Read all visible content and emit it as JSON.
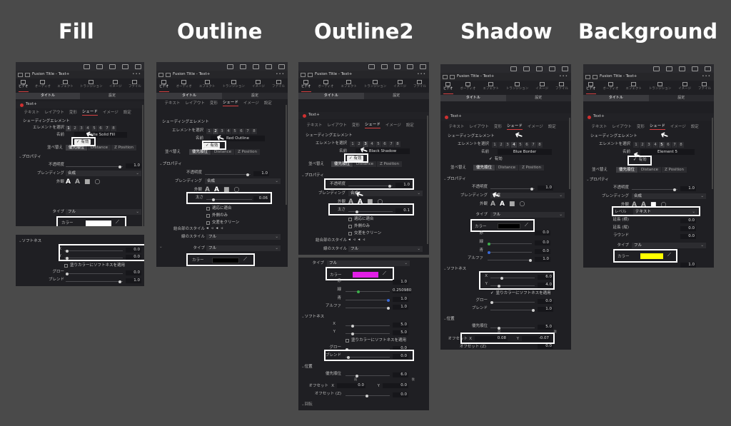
{
  "columns": [
    {
      "key": "fill",
      "title": "Fill"
    },
    {
      "key": "outline",
      "title": "Outline"
    },
    {
      "key": "outline2",
      "title": "Outline2"
    },
    {
      "key": "shadow",
      "title": "Shadow"
    },
    {
      "key": "background",
      "title": "Background"
    }
  ],
  "common": {
    "window_title": "Fusion Title - Text+",
    "more": "•••",
    "tabs": [
      "ビデオ",
      "オーディオ",
      "エフェクト",
      "トランジション",
      "イメージ",
      "ファイル"
    ],
    "subtabs": [
      "タイトル",
      "設定"
    ],
    "tool_name": "Text+",
    "inner_tabs": [
      "テキスト",
      "レイアウト",
      "変形",
      "シェード",
      "イメージ",
      "設定"
    ],
    "shading_element": "シェーディングエレメント",
    "select_element": "エレメントを選択",
    "element_numbers": [
      "1",
      "2",
      "3",
      "4",
      "5",
      "6",
      "7",
      "8"
    ],
    "name_label": "名前",
    "enabled": "有効",
    "sort_label": "並べ替え",
    "sort_options": [
      "優先順位",
      "Distance",
      "Z Position"
    ],
    "properties": "プロパティ",
    "opacity": "不透明度",
    "blending": "ブレンディング",
    "blending_value": "合成",
    "appearance": "外観",
    "type": "タイプ",
    "type_value": "フル",
    "color": "カラー",
    "softness": "ソフトネス",
    "softness_apply": "塗りカラーにソフトネスを適用",
    "glow": "グロー",
    "blend": "ブレンド",
    "size": "太さ",
    "adapt": "適応に適合",
    "outside_only": "外側のみ",
    "cleaner": "交差をクリーン",
    "join_style": "結合部のスタイル",
    "line_style": "線のスタイル",
    "red": "赤",
    "green": "緑",
    "blue": "青",
    "alpha": "アルファ",
    "position": "位置",
    "priority": "優先順位",
    "offset": "オフセット",
    "offset_z": "オフセット (Z)",
    "rotation": "回転",
    "level": "レベル",
    "level_value": "テキスト",
    "extend_h": "延長 (横)",
    "extend_v": "延長 (縦)",
    "round": "ラウンド",
    "front": "前",
    "back": "後"
  },
  "fill": {
    "element": "1",
    "name": "White Solid Fill",
    "opacity": "1.0",
    "swatch": "#ffffff",
    "x": "0.0",
    "y": "0.0",
    "glow": "0.0",
    "blend": "1.0"
  },
  "outline": {
    "element": "2",
    "name": "Red Outline",
    "opacity": "1.0",
    "size": "0.06",
    "swatch": "#000000"
  },
  "outline2": {
    "element": "3",
    "name": "Black Shadow",
    "opacity": "1.0",
    "size": "0.1",
    "swatch": "#e21ee6",
    "c1": "1.0",
    "c2": "0.250980",
    "c3": "1.0",
    "alpha": "1.0",
    "x": "5.0",
    "y": "5.0",
    "glow": "0.0",
    "blend": "0.0",
    "priority": "6.0",
    "offx": "0.0",
    "offy": "0.0",
    "offz": "0.0"
  },
  "shadow": {
    "element": "4",
    "name": "Blue Border",
    "opacity": "1.0",
    "swatch": "#000000",
    "c1": "0.0",
    "c2": "0.0",
    "c3": "0.0",
    "alpha": "1.0",
    "x": "6.0",
    "y": "4.0",
    "glow": "0.0",
    "blend": "1.0",
    "priority": "5.0",
    "offx": "0.08",
    "offy": "-0.07",
    "offz": "0.0"
  },
  "background": {
    "element": "5",
    "name": "Element 5",
    "opacity": "1.0",
    "extend_h": "0.0",
    "extend_v": "0.0",
    "round": "0.0",
    "swatch": "#ffff00",
    "alpha": "1.0"
  }
}
